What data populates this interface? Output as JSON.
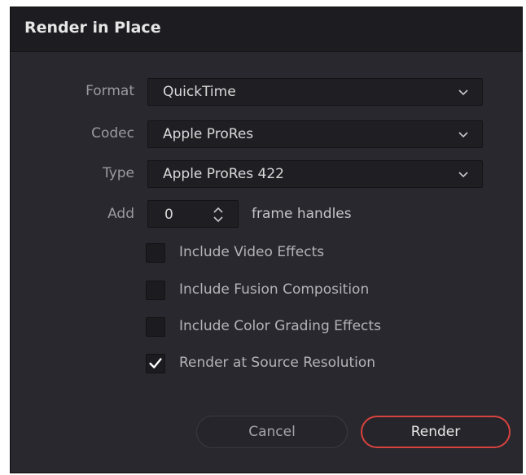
{
  "dialog": {
    "title": "Render in Place"
  },
  "form": {
    "format": {
      "label": "Format",
      "value": "QuickTime"
    },
    "codec": {
      "label": "Codec",
      "value": "Apple ProRes"
    },
    "type": {
      "label": "Type",
      "value": "Apple ProRes 422"
    },
    "add": {
      "label": "Add",
      "value": "0",
      "suffix": "frame handles"
    }
  },
  "options": [
    {
      "label": "Include Video Effects",
      "checked": false
    },
    {
      "label": "Include Fusion Composition",
      "checked": false
    },
    {
      "label": "Include Color Grading Effects",
      "checked": false
    },
    {
      "label": "Render at Source Resolution",
      "checked": true
    }
  ],
  "buttons": {
    "cancel": "Cancel",
    "render": "Render"
  },
  "colors": {
    "dialog_background": "#28282e",
    "titlebar_background": "#1d1d21",
    "accent_red": "#d9433e"
  }
}
